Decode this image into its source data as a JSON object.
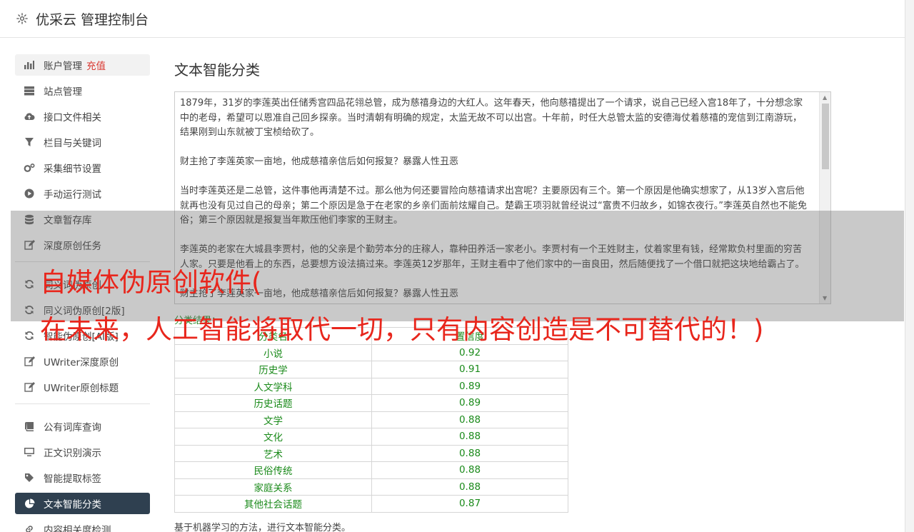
{
  "app": {
    "title": "优采云 管理控制台"
  },
  "sidebar": {
    "group1": [
      {
        "label": "账户管理",
        "extra": "充值",
        "icon": "bar-chart-icon"
      },
      {
        "label": "站点管理",
        "icon": "server-icon"
      },
      {
        "label": "接口文件相关",
        "icon": "cloud-upload-icon"
      },
      {
        "label": "栏目与关键词",
        "icon": "filter-icon"
      },
      {
        "label": "采集细节设置",
        "icon": "gears-icon"
      },
      {
        "label": "手动运行测试",
        "icon": "play-circle-icon"
      },
      {
        "label": "文章暂存库",
        "icon": "database-icon"
      },
      {
        "label": "深度原创任务",
        "icon": "edit-icon"
      }
    ],
    "group2": [
      {
        "label": "同义词伪原创",
        "icon": "refresh-icon"
      },
      {
        "label": "同义词伪原创[2版]",
        "icon": "refresh-icon"
      },
      {
        "label": "智能伪原创[AI版]",
        "icon": "refresh-icon"
      },
      {
        "label": "UWriter深度原创",
        "icon": "edit-icon"
      },
      {
        "label": "UWriter原创标题",
        "icon": "edit-icon"
      }
    ],
    "group3": [
      {
        "label": "公有词库查询",
        "icon": "book-icon"
      },
      {
        "label": "正文识别演示",
        "icon": "monitor-icon"
      },
      {
        "label": "智能提取标签",
        "icon": "tag-icon"
      },
      {
        "label": "文本智能分类",
        "icon": "pie-chart-icon"
      },
      {
        "label": "内容相关度检测",
        "icon": "link-icon"
      }
    ]
  },
  "main": {
    "title": "文本智能分类",
    "text": "1879年，31岁的李莲英出任储秀宫四品花翎总管，成为慈禧身边的大红人。这年春天，他向慈禧提出了一个请求，说自己已经入宫18年了，十分想念家中的老母，希望可以恩准自己回乡探亲。当时清朝有明确的规定，太监无故不可以出宫。十年前，时任大总管太监的安德海仗着慈禧的宠信到江南游玩，结果刚到山东就被丁宝桢给砍了。\n\n财主抢了李莲英家一亩地，他成慈禧亲信后如何报复？暴露人性丑恶\n\n当时李莲英还是二总管，这件事他再清楚不过。那么他为何还要冒险向慈禧请求出宫呢？主要原因有三个。第一个原因是他确实想家了，从13岁入宫后他就再也没有见过自己的母亲；第二个原因是急于在老家的乡亲们面前炫耀自己。楚霸王项羽就曾经说过“富贵不归故乡，如锦衣夜行。”李莲英自然也不能免俗；第三个原因就是报复当年欺压他们李家的王财主。\n\n李莲英的老家在大城县李贾村，他的父亲是个勤劳本分的庄稼人，靠种田养活一家老小。李贾村有一个王姓财主，仗着家里有钱，经常欺负村里面的穷苦人家。只要是他看上的东西，总要想方设法搞过来。李莲英12岁那年，王财主看中了他们家中的一亩良田，然后随便找了一个借口就把这块地给霸占了。\n\n财主抢了李莲英家一亩地，他成慈禧亲信后如何报复？暴露人性丑恶",
    "result_label": "分类结果：",
    "table_headers": [
      "分类名",
      "置信度"
    ],
    "rows": [
      [
        "小说",
        "0.92"
      ],
      [
        "历史学",
        "0.91"
      ],
      [
        "人文学科",
        "0.89"
      ],
      [
        "历史话题",
        "0.89"
      ],
      [
        "文学",
        "0.88"
      ],
      [
        "文化",
        "0.88"
      ],
      [
        "艺术",
        "0.88"
      ],
      [
        "民俗传统",
        "0.88"
      ],
      [
        "家庭关系",
        "0.88"
      ],
      [
        "其他社会话题",
        "0.87"
      ]
    ],
    "footer": "基于机器学习的方法，进行文本智能分类。"
  },
  "overlay": {
    "line1": "自媒体伪原创软件(",
    "line2": "在未来，人工智能将取代一切，只有内容创造是不可替代的！)"
  }
}
